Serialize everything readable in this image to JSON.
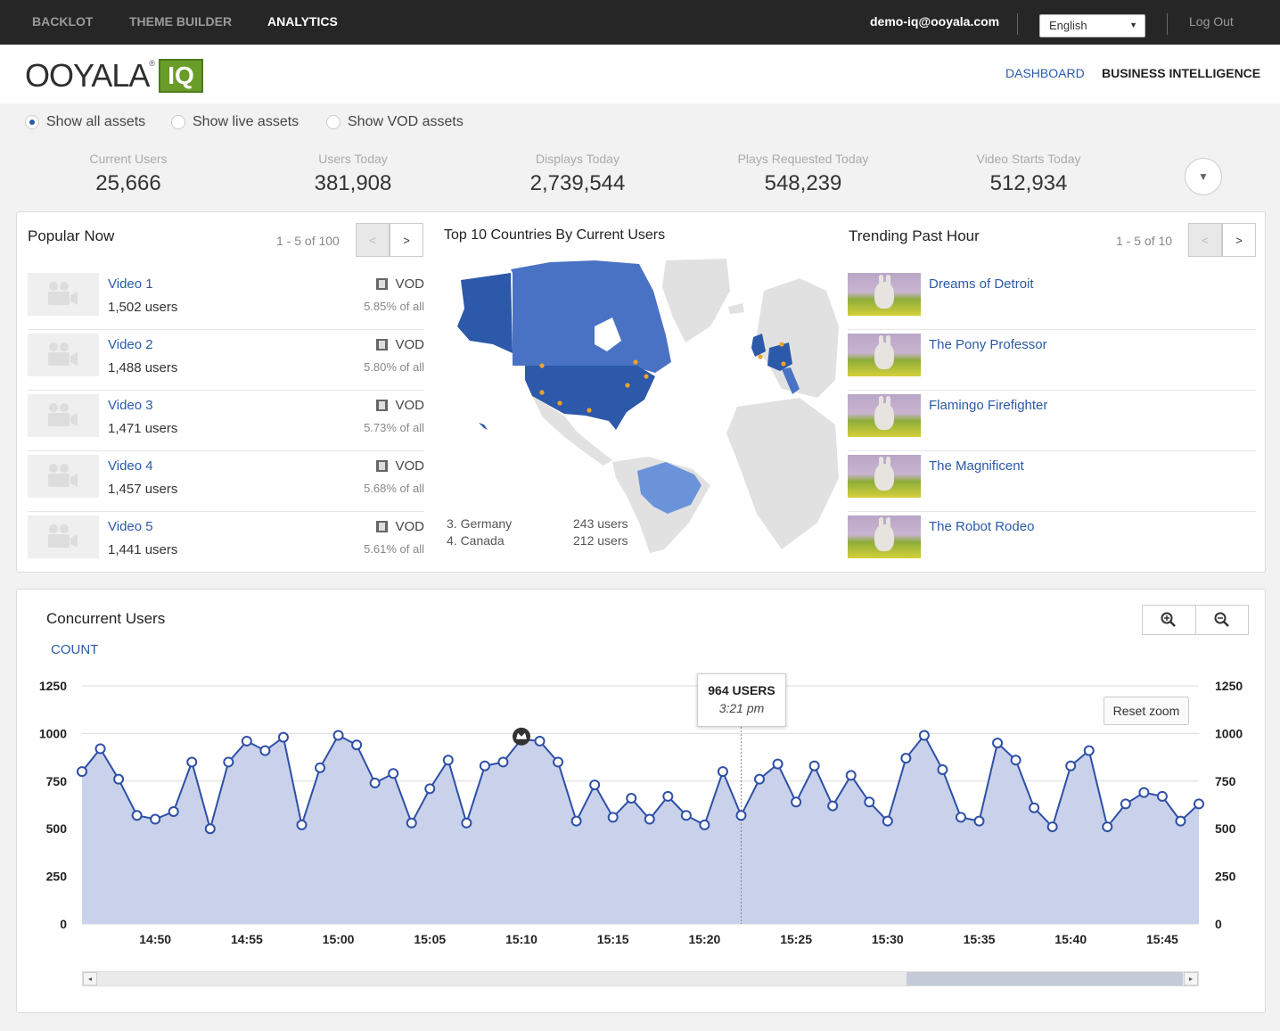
{
  "topnav": {
    "items": [
      "BACKLOT",
      "THEME BUILDER",
      "ANALYTICS"
    ],
    "email": "demo-iq@ooyala.com",
    "language": "English",
    "logout": "Log Out"
  },
  "header": {
    "logo_text": "OOYALA",
    "logo_reg": "®",
    "logo_badge": "IQ",
    "links": [
      "DASHBOARD",
      "BUSINESS INTELLIGENCE"
    ]
  },
  "filters": {
    "options": [
      "Show all assets",
      "Show live assets",
      "Show VOD assets"
    ],
    "selected": 0
  },
  "stats": [
    {
      "label": "Current Users",
      "value": "25,666"
    },
    {
      "label": "Users Today",
      "value": "381,908"
    },
    {
      "label": "Displays Today",
      "value": "2,739,544"
    },
    {
      "label": "Plays Requested Today",
      "value": "548,239"
    },
    {
      "label": "Video Starts Today",
      "value": "512,934"
    }
  ],
  "popular": {
    "title": "Popular Now",
    "pager": "1 - 5 of 100",
    "prev": "<",
    "next": ">",
    "items": [
      {
        "name": "Video 1",
        "users": "1,502 users",
        "type": "VOD",
        "pct": "5.85% of all"
      },
      {
        "name": "Video 2",
        "users": "1,488 users",
        "type": "VOD",
        "pct": "5.80% of all"
      },
      {
        "name": "Video 3",
        "users": "1,471 users",
        "type": "VOD",
        "pct": "5.73% of all"
      },
      {
        "name": "Video 4",
        "users": "1,457 users",
        "type": "VOD",
        "pct": "5.68% of all"
      },
      {
        "name": "Video 5",
        "users": "1,441 users",
        "type": "VOD",
        "pct": "5.61% of all"
      }
    ]
  },
  "map": {
    "title": "Top 10 Countries By Current Users",
    "legend": [
      {
        "country": "3. Germany",
        "users": "243 users"
      },
      {
        "country": "4. Canada",
        "users": "212 users"
      }
    ],
    "colors": {
      "dark": "#2c59a9",
      "mid": "#4a72c4",
      "light": "#6b93da",
      "land": "#e1e1e1",
      "marker": "#f2a125"
    }
  },
  "trending": {
    "title": "Trending Past Hour",
    "pager": "1 - 5 of 10",
    "prev": "<",
    "next": ">",
    "items": [
      "Dreams of Detroit",
      "The Pony Professor",
      "Flamingo Firefighter",
      "The Magnificent",
      "The Robot Rodeo"
    ]
  },
  "concurrent": {
    "title": "Concurrent Users",
    "series_label": "COUNT",
    "reset_zoom": "Reset zoom",
    "tooltip": {
      "value": "964 USERS",
      "time": "3:21 pm"
    }
  },
  "chart_data": {
    "type": "area",
    "title": "Concurrent Users",
    "ylabel": "COUNT",
    "ylim": [
      0,
      1250
    ],
    "yticks": [
      0,
      250,
      500,
      750,
      1000,
      1250
    ],
    "xticks": [
      "14:50",
      "14:55",
      "15:00",
      "15:05",
      "15:10",
      "15:15",
      "15:20",
      "15:25",
      "15:30",
      "15:35",
      "15:40",
      "15:45"
    ],
    "x_minutes_start": "14:46",
    "x_step_minutes": 1,
    "values": [
      800,
      920,
      760,
      570,
      550,
      590,
      850,
      500,
      850,
      960,
      910,
      980,
      520,
      820,
      990,
      940,
      740,
      790,
      530,
      710,
      860,
      530,
      830,
      850,
      970,
      960,
      850,
      540,
      730,
      560,
      660,
      550,
      670,
      570,
      520,
      800,
      570,
      760,
      840,
      640,
      830,
      620,
      780,
      640,
      540,
      870,
      990,
      810,
      560,
      540,
      950,
      860,
      610,
      510,
      830,
      910,
      510,
      630,
      690,
      670,
      540,
      630
    ],
    "grid": true,
    "color": "#2e4fa6",
    "fill": "#c9d2ea"
  }
}
